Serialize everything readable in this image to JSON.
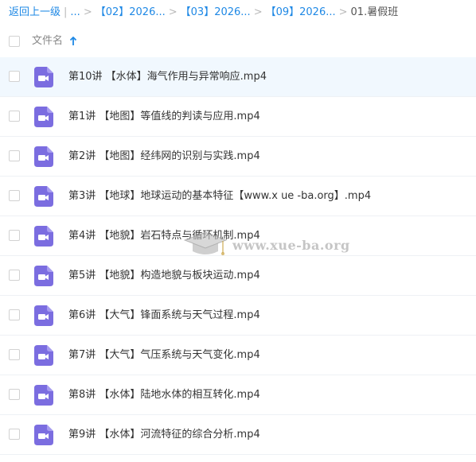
{
  "breadcrumb": {
    "back": "返回上一级",
    "separator": "|",
    "ellipsis": "...",
    "crumbs": [
      "【02】2026...",
      "【03】2026...",
      "【09】2026..."
    ],
    "arrow": ">",
    "current": "01.暑假班"
  },
  "header": {
    "file_name_label": "文件名",
    "sort_icon": "arrow-up-icon"
  },
  "files": [
    {
      "name": "第10讲 【水体】海气作用与异常响应.mp4",
      "icon": "video-file-icon",
      "selected": true
    },
    {
      "name": "第1讲 【地图】等值线的判读与应用.mp4",
      "icon": "video-file-icon",
      "selected": false
    },
    {
      "name": "第2讲 【地图】经纬网的识别与实践.mp4",
      "icon": "video-file-icon",
      "selected": false
    },
    {
      "name": "第3讲 【地球】地球运动的基本特征【www.x ue -ba.org】.mp4",
      "icon": "video-file-icon",
      "selected": false
    },
    {
      "name": "第4讲 【地貌】岩石特点与循环机制.mp4",
      "icon": "video-file-icon",
      "selected": false
    },
    {
      "name": "第5讲 【地貌】构造地貌与板块运动.mp4",
      "icon": "video-file-icon",
      "selected": false
    },
    {
      "name": "第6讲 【大气】锋面系统与天气过程.mp4",
      "icon": "video-file-icon",
      "selected": false
    },
    {
      "name": "第7讲 【大气】气压系统与天气变化.mp4",
      "icon": "video-file-icon",
      "selected": false
    },
    {
      "name": "第8讲 【水体】陆地水体的相互转化.mp4",
      "icon": "video-file-icon",
      "selected": false
    },
    {
      "name": "第9讲 【水体】河流特征的综合分析.mp4",
      "icon": "video-file-icon",
      "selected": false
    }
  ],
  "watermark": {
    "text": "www.xue-ba.org"
  },
  "colors": {
    "link": "#1e88e5",
    "icon_purple": "#7b6de0",
    "selected_row": "#f1f8fe"
  }
}
